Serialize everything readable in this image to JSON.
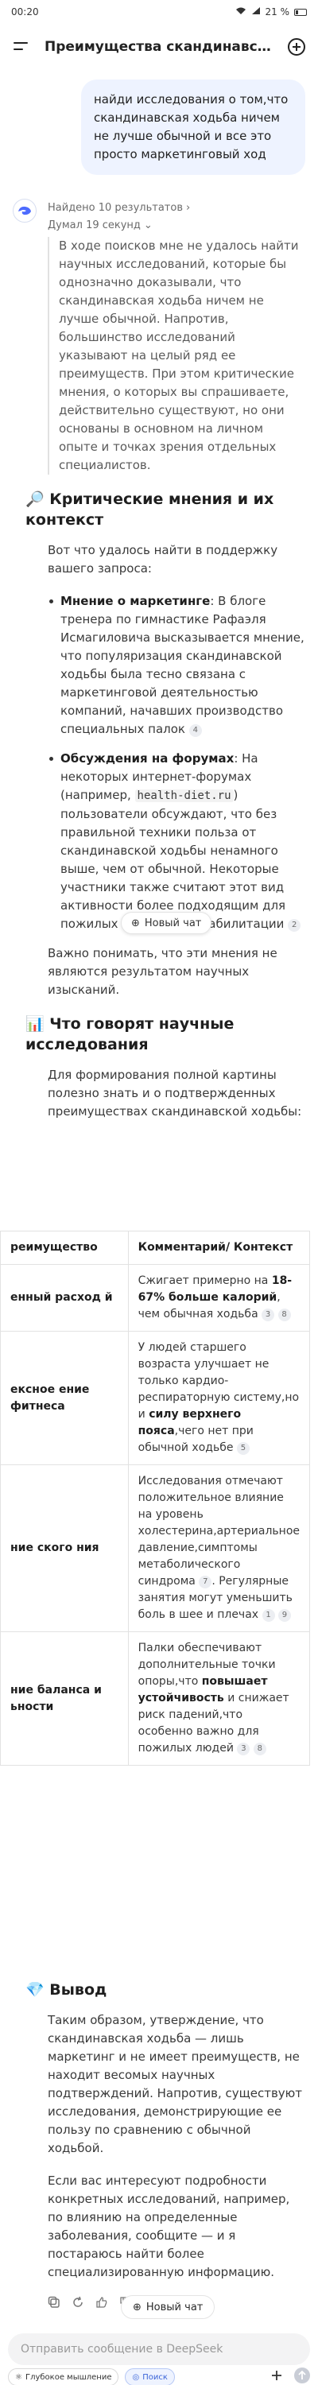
{
  "status": {
    "time": "00:20",
    "battery": "21 %"
  },
  "header": {
    "title": "Преимущества скандинавс…"
  },
  "user_message": "найди исследования о том,что скандинавская ходьба ничем не лучше обычной и все это просто маркетинговый ход",
  "assistant": {
    "search_results": "Найдено 10 результатов",
    "thought_time": "Думал 19 секунд",
    "thinking": "В ходе поисков мне не удалось найти научных исследований, которые бы однозначно доказывали, что скандинавская ходьба ничем не лучше обычной. Напротив, большинство исследований указывают на целый ряд ее преимуществ. При этом критические мнения, о которых вы спрашиваете, действительно существуют, но они основаны в основном на личном опыте и точках зрения отдельных специалистов.",
    "section1_title": "🔎 Критические мнения и их контекст",
    "section1_intro": "Вот что удалось найти в поддержку вашего запроса:",
    "bullet1_title": "Мнение о маркетинге",
    "bullet1_text": ": В блоге тренера по гимнастике Рафаэля Исмагиловича высказывается мнение, что популяризация скандинавской ходьбы была тесно связана с маркетинговой деятельностью компаний, начавших производство специальных палок",
    "bullet1_cite": "4",
    "bullet2_title": "Обсуждения на форумах",
    "bullet2_text_a": ": На некоторых интернет-форумах (например, ",
    "bullet2_code": "health-diet.ru",
    "bullet2_text_b": ") пользователи обсуждают, что без правильной техники польза от скандинавской ходьбы ненамного выше, чем от обычной. Некоторые участники также считают этот вид активности более подходящим для пожилых людей или реабилитации",
    "bullet2_cite": "2",
    "new_chat_float": "Новый чат",
    "section1_note": "Важно понимать, что эти мнения не являются результатом научных изысканий.",
    "section2_title": "📊 Что говорят научные исследования",
    "section2_intro": "Для формирования полной картины полезно знать и о подтвержденных преимуществах скандинавской ходьбы:",
    "table": {
      "col1": "реимущество",
      "col2": "Комментарий/ Контекст",
      "rows": [
        {
          "c1": "енный расход й",
          "c2a": "Сжигает примерно на ",
          "c2b": "18-67% больше калорий",
          "c2c": ", чем обычная ходьба",
          "cites": [
            "3",
            "8"
          ]
        },
        {
          "c1": "ексное ение фитнеса",
          "c2a": "У людей старшего возраста улучшает не только кардио-респираторную систему,но и ",
          "c2b": "силу верхнего пояса",
          "c2c": ",чего нет при обычной ходьбе",
          "cites": [
            "5"
          ]
        },
        {
          "c1": "ние ского ния",
          "c2a": "Исследования отмечают положительное влияние на уровень холестерина,артериальное давление,симптомы метаболического синдрома",
          "c2b": "",
          "c2c": ". Регулярные занятия могут уменьшить боль в шее и плечах",
          "cites": [
            "7",
            "1",
            "9"
          ]
        },
        {
          "c1": "ние баланса и ьности",
          "c2a": "Палки обеспечивают дополнительные точки опоры,что ",
          "c2b": "повышает устойчивость",
          "c2c": " и снижает риск падений,что особенно важно для пожилых людей",
          "cites": [
            "3",
            "8"
          ]
        }
      ]
    },
    "section3_title": "💎 Вывод",
    "conclusion": "Таким образом, утверждение, что скандинавская ходьба — лишь маркетинг и не имеет преимуществ, не находит весомых научных подтверждений. Напротив, существуют исследования, демонстрирующие ее пользу по сравнению с обычной ходьбой.",
    "followup": "Если вас интересуют подробности конкретных исследований, например, по влиянию на определенные заболевания, сообщите — и я постараюсь найти более специализированную информацию."
  },
  "new_chat_button": "Новый чат",
  "input_placeholder": "Отправить сообщение в DeepSeek",
  "toolbar": {
    "deep_think": "Глубокое мышление",
    "search": "Поиск"
  },
  "colors": {
    "accent": "#3a64d8",
    "bubble": "#eef3ff"
  }
}
